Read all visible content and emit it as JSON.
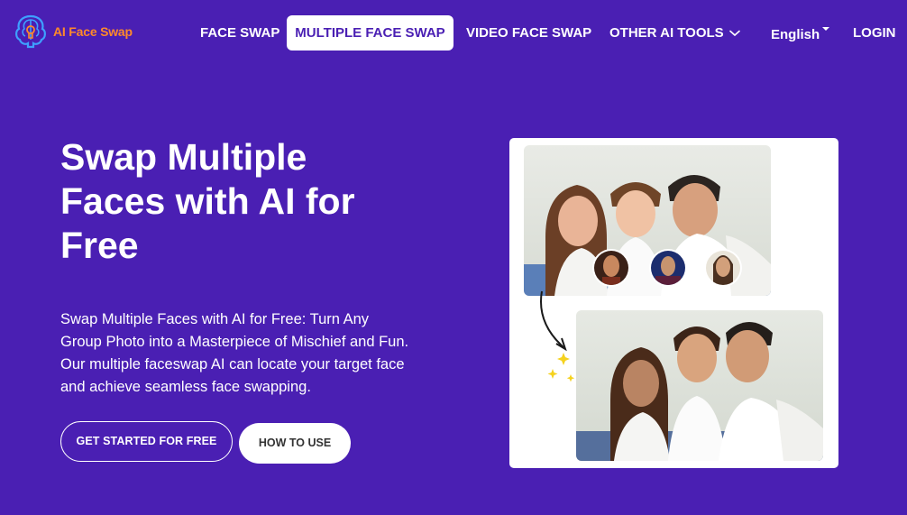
{
  "header": {
    "logo_text": "AI Face Swap",
    "nav": {
      "face_swap": "FACE SWAP",
      "multiple_face_swap": "MULTIPLE FACE SWAP",
      "video_face_swap": "VIDEO FACE SWAP",
      "other_ai_tools": "OTHER AI TOOLS"
    },
    "language": "English",
    "login": "LOGIN"
  },
  "hero": {
    "title": "Swap Multiple Faces with AI for Free",
    "description": "Swap Multiple Faces with AI for Free: Turn Any Group Photo into a Masterpiece of Mischief and Fun. Our multiple faceswap AI can locate your target face and achieve seamless face swapping.",
    "primary_button": "GET STARTED FOR FREE",
    "secondary_button": "HOW TO USE"
  },
  "colors": {
    "background": "#4a1fb3",
    "logo_text": "#ff8a2a",
    "active_tab_text": "#4a1fb3",
    "white": "#ffffff"
  },
  "icons": {
    "logo": "brain-bulb-icon",
    "dropdown": "chevron-down-icon",
    "language_caret": "caret-down-icon",
    "arrow": "curved-arrow-icon"
  }
}
